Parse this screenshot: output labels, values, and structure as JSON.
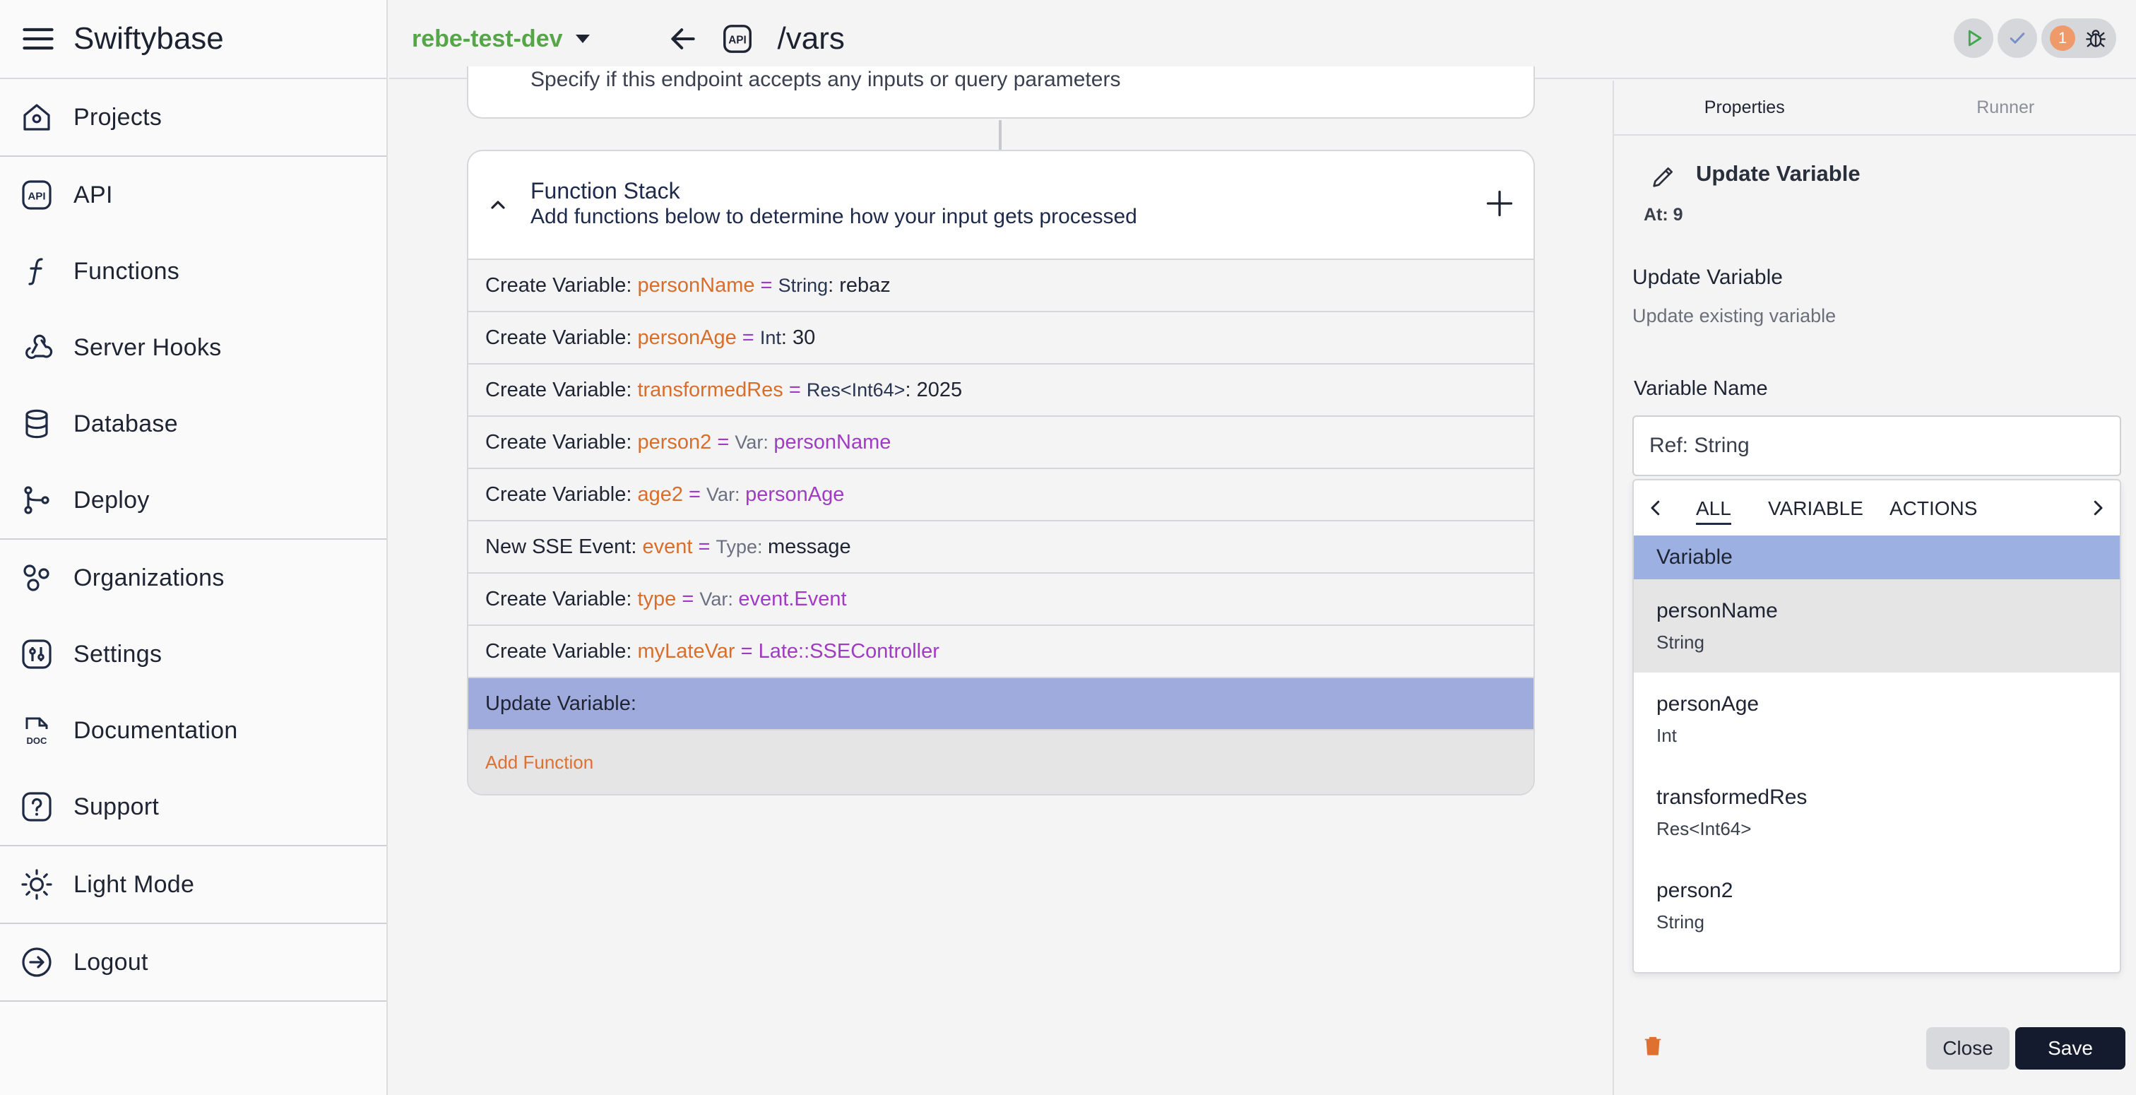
{
  "app": {
    "title": "Swiftybase"
  },
  "sidebar": {
    "groups": [
      [
        {
          "label": "Projects",
          "icon": "home-icon"
        }
      ],
      [
        {
          "label": "API",
          "icon": "api-icon"
        },
        {
          "label": "Functions",
          "icon": "function-icon"
        },
        {
          "label": "Server Hooks",
          "icon": "webhook-icon"
        },
        {
          "label": "Database",
          "icon": "database-icon"
        },
        {
          "label": "Deploy",
          "icon": "git-branch-icon"
        }
      ],
      [
        {
          "label": "Organizations",
          "icon": "organizations-icon"
        },
        {
          "label": "Settings",
          "icon": "settings-icon"
        },
        {
          "label": "Documentation",
          "icon": "documentation-icon"
        },
        {
          "label": "Support",
          "icon": "help-icon"
        }
      ],
      [
        {
          "label": "Light Mode",
          "icon": "sun-icon"
        }
      ],
      [
        {
          "label": "Logout",
          "icon": "logout-icon"
        }
      ]
    ]
  },
  "header": {
    "environment": "rebe-test-dev",
    "path": "/vars",
    "notification_count": "1",
    "colors": {
      "environment": "#56a548",
      "badge": "#ef9a6a"
    }
  },
  "input_card": {
    "subtitle": "Specify if this endpoint accepts any inputs or query parameters"
  },
  "function_stack": {
    "title": "Function Stack",
    "subtitle": "Add functions below to determine how your input gets processed",
    "rows": [
      {
        "prefix": "Create Variable: ",
        "name": "personName",
        "eq": " = ",
        "type": "String",
        "value": ": rebaz",
        "kind": "literal"
      },
      {
        "prefix": "Create Variable: ",
        "name": "personAge",
        "eq": " = ",
        "type": "Int",
        "value": ": 30",
        "kind": "literal"
      },
      {
        "prefix": "Create Variable: ",
        "name": "transformedRes",
        "eq": " = ",
        "type": "Res<Int64>",
        "value": ": 2025",
        "kind": "literal"
      },
      {
        "prefix": "Create Variable: ",
        "name": "person2",
        "eq": " = ",
        "type": "Var: ",
        "value": "personName",
        "kind": "var"
      },
      {
        "prefix": "Create Variable: ",
        "name": "age2",
        "eq": " = ",
        "type": "Var: ",
        "value": "personAge",
        "kind": "var"
      },
      {
        "prefix": "New SSE Event: ",
        "name": "event",
        "eq": " = ",
        "type": "Type: ",
        "value": "message",
        "kind": "typed"
      },
      {
        "prefix": "Create Variable: ",
        "name": "type",
        "eq": " = ",
        "type": "Var: ",
        "value": "event.Event",
        "kind": "var"
      },
      {
        "prefix": "Create Variable: ",
        "name": "myLateVar",
        "eq": " = ",
        "type": "",
        "value": "Late::SSEController",
        "kind": "late"
      }
    ],
    "selected_row": "Update Variable:",
    "add_label": "Add Function",
    "colors": {
      "name": "#d96e2a",
      "operator": "#a13bc4",
      "selected": "#a0abdd"
    }
  },
  "panel": {
    "tabs": [
      "Properties",
      "Runner"
    ],
    "heading": "Update Variable",
    "position": "At: 9",
    "section_title": "Update Variable",
    "section_subtitle": "Update existing variable",
    "field_label": "Variable Name",
    "field_value": "Ref: String",
    "dropdown": {
      "tabs": [
        "ALL",
        "VARIABLE",
        "ACTIONS"
      ],
      "group": "Variable",
      "items": [
        {
          "name": "personName",
          "type": "String"
        },
        {
          "name": "personAge",
          "type": "Int"
        },
        {
          "name": "transformedRes",
          "type": "Res<Int64>"
        },
        {
          "name": "person2",
          "type": "String"
        }
      ]
    },
    "close_label": "Close",
    "save_label": "Save"
  }
}
